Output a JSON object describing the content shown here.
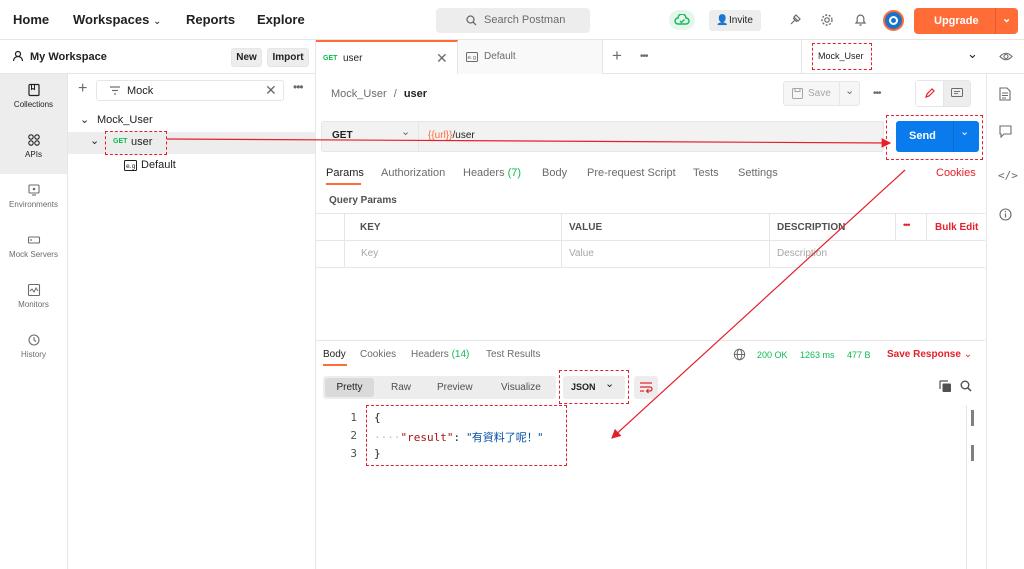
{
  "topbar": {
    "nav": [
      "Home",
      "Workspaces",
      "Reports",
      "Explore"
    ],
    "search_placeholder": "Search Postman",
    "invite": "Invite",
    "upgrade": "Upgrade"
  },
  "workspace": {
    "name": "My Workspace",
    "new": "New",
    "import": "Import"
  },
  "rail": [
    "Collections",
    "APIs",
    "Environments",
    "Mock Servers",
    "Monitors",
    "History"
  ],
  "sidebar": {
    "filter": "Mock",
    "collection": "Mock_User",
    "request_method": "GET",
    "request_name": "user",
    "example": "Default"
  },
  "tabs": [
    {
      "method": "GET",
      "label": "user"
    },
    {
      "label": "Default"
    }
  ],
  "env": "Mock_User",
  "breadcrumb": {
    "parent": "Mock_User",
    "sep": "/",
    "current": "user"
  },
  "save": "Save",
  "request": {
    "method": "GET",
    "url_var": "{{url}}",
    "url_path": "/user",
    "send": "Send"
  },
  "req_tabs": [
    "Params",
    "Authorization",
    "Headers",
    "(7)",
    "Body",
    "Pre-request Script",
    "Tests",
    "Settings"
  ],
  "cookies": "Cookies",
  "query_params": {
    "title": "Query Params",
    "headers": [
      "KEY",
      "VALUE",
      "DESCRIPTION"
    ],
    "placeholders": [
      "Key",
      "Value",
      "Description"
    ],
    "bulk_edit": "Bulk Edit"
  },
  "response": {
    "tabs": [
      "Body",
      "Cookies",
      "Headers",
      "(14)",
      "Test Results"
    ],
    "status": "200 OK",
    "time": "1263 ms",
    "size": "477 B",
    "save_response": "Save Response",
    "views": [
      "Pretty",
      "Raw",
      "Preview",
      "Visualize"
    ],
    "format": "JSON",
    "lines": [
      {
        "n": "1",
        "text": "{"
      },
      {
        "n": "2",
        "dots": "····",
        "key": "\"result\"",
        "colon": ": ",
        "value": "\"有資料了呢！\""
      },
      {
        "n": "3",
        "text": "}"
      }
    ]
  },
  "colors": {
    "accent": "#ff6c37",
    "send": "#097bed",
    "annotation": "#e4202b",
    "green": "#0cbb52"
  }
}
